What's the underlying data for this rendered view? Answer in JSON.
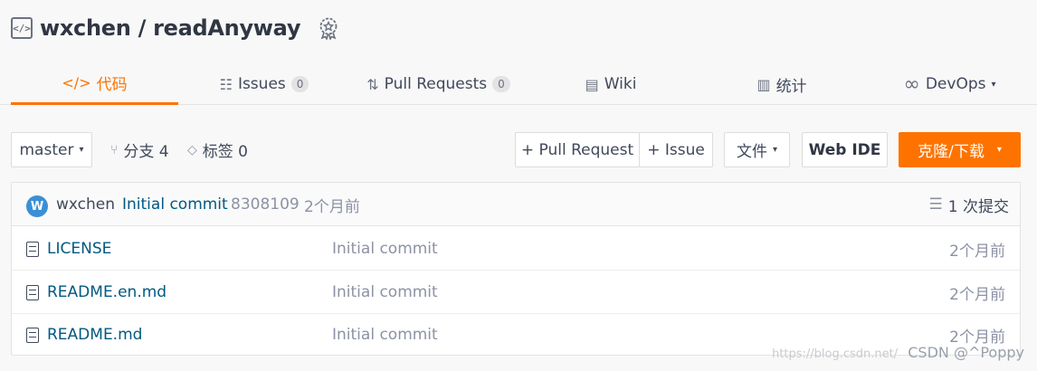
{
  "repo": {
    "owner_repo": "wxchen / readAnyway",
    "repo_icon_glyph": "</>",
    "badge_icon": "award-icon"
  },
  "tabs": [
    {
      "label": "代码",
      "icon": "code-icon",
      "glyph": "</>"
    },
    {
      "label": "Issues",
      "count": "0",
      "icon": "issues-icon",
      "glyph": "☷"
    },
    {
      "label": "Pull Requests",
      "count": "0",
      "icon": "pull-request-icon",
      "glyph": "⇅"
    },
    {
      "label": "Wiki",
      "icon": "book-icon",
      "glyph": "▤"
    },
    {
      "label": "统计",
      "icon": "stats-icon",
      "glyph": "▥"
    },
    {
      "label": "DevOps",
      "icon": "infinity-icon",
      "glyph": "∞",
      "caret": "▾"
    }
  ],
  "toolbar": {
    "branch": "master",
    "branch_caret": "▾",
    "branches_label": "分支 4",
    "branches_glyph": "⑂",
    "tags_label": "标签 0",
    "tags_glyph": "◇",
    "pull_request": "+ Pull Request",
    "issue": "+ Issue",
    "file_menu": "文件",
    "file_caret": "▾",
    "web_ide": "Web IDE",
    "clone": "克隆/下载",
    "clone_caret": "▾"
  },
  "commit_bar": {
    "avatar_letter": "W",
    "author": "wxchen",
    "message": "Initial commit",
    "hash": "8308109",
    "time": "2个月前",
    "commits": "1 次提交",
    "commits_glyph": "☰"
  },
  "files": [
    {
      "name": "LICENSE",
      "commit": "Initial commit",
      "time": "2个月前"
    },
    {
      "name": "README.en.md",
      "commit": "Initial commit",
      "time": "2个月前"
    },
    {
      "name": "README.md",
      "commit": "Initial commit",
      "time": "2个月前"
    }
  ],
  "watermark": {
    "faint": "https://blog.csdn.net/",
    "text": "CSDN @^Poppy"
  },
  "colors": {
    "accent": "#fe7300",
    "link": "#005980",
    "muted": "#8c92a4",
    "avatar": "#3b8fd6"
  }
}
